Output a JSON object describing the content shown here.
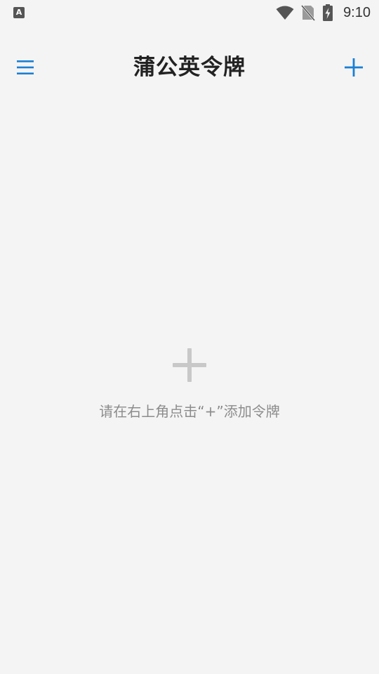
{
  "status_bar": {
    "left_icon": "A",
    "left_icon_name": "keyboard-notification-icon",
    "right_icons": [
      "wifi-icon",
      "no-sim-icon",
      "battery-charging-icon"
    ],
    "time": "9:10"
  },
  "toolbar": {
    "title": "蒲公英令牌",
    "menu_icon": "hamburger-menu-icon",
    "add_icon": "plus-icon",
    "accent_color": "#1a7fd4"
  },
  "empty_state": {
    "icon": "plus-icon",
    "hint": "请在右上角点击“+”添加令牌",
    "icon_color": "#c8c8c8",
    "text_color": "#8c8c8c"
  }
}
